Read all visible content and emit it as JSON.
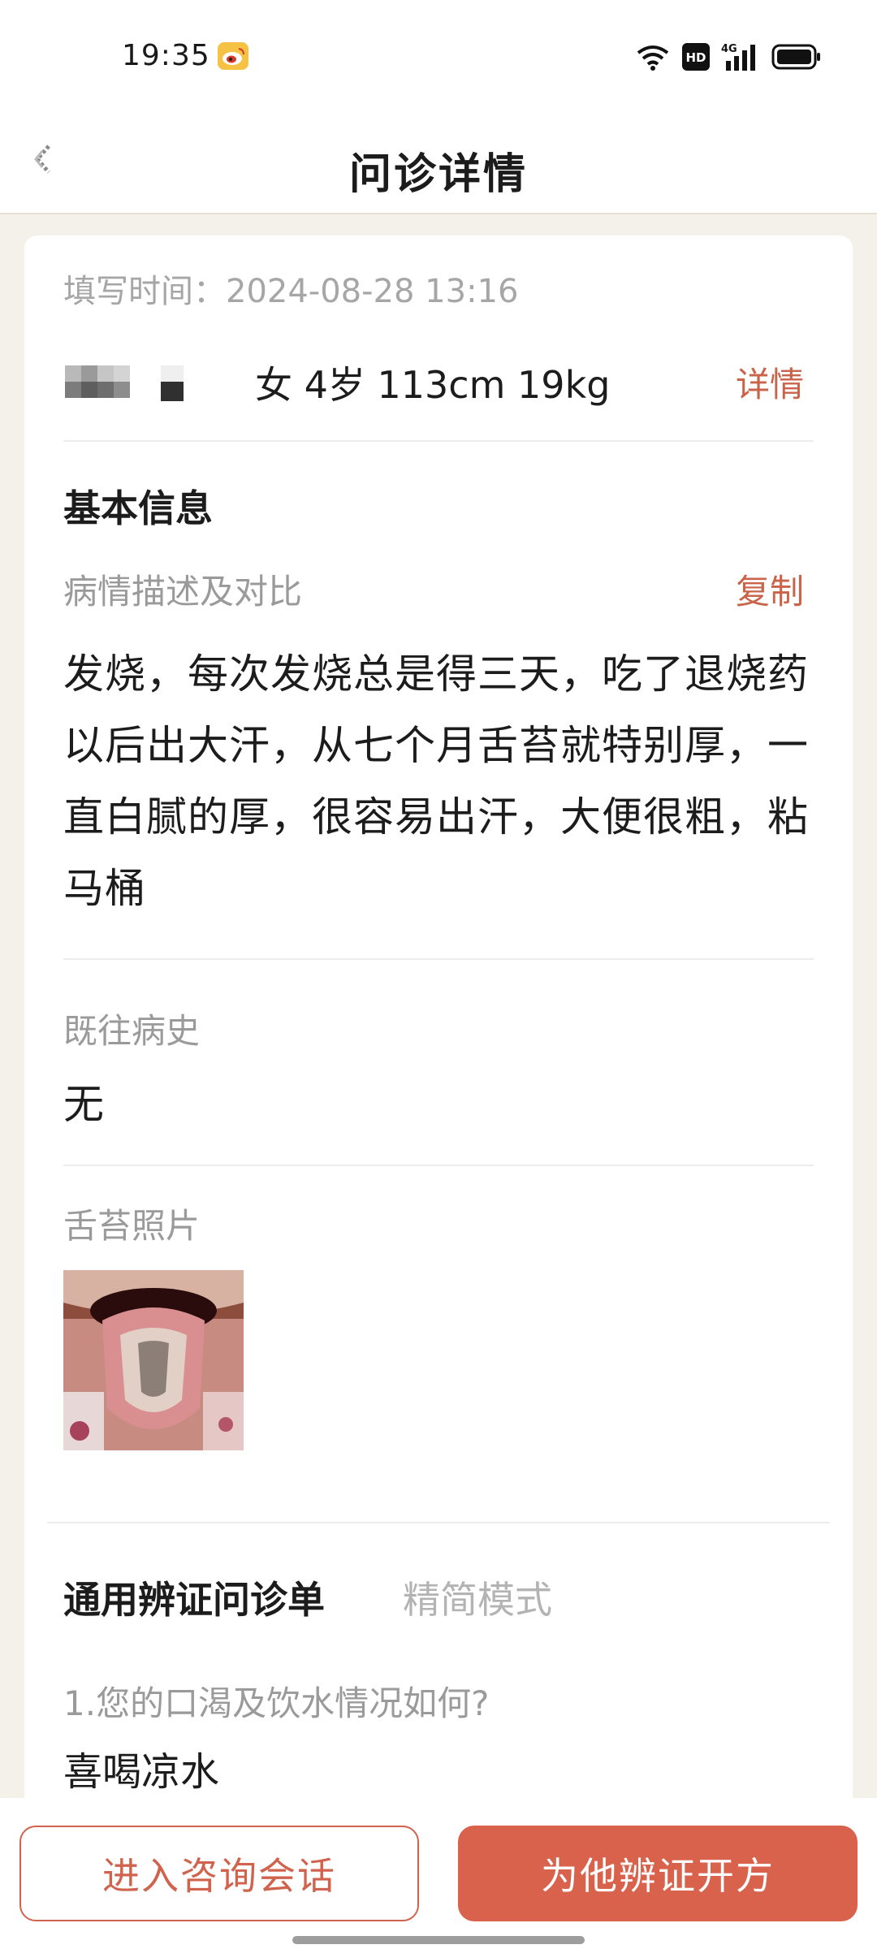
{
  "status_bar": {
    "time": "19:35",
    "app_icon": "weibo-icon",
    "indicators": [
      "wifi-icon",
      "hd-icon",
      "signal-4g-icon",
      "battery-icon"
    ],
    "hd_label": "HD",
    "network_label": "4G"
  },
  "nav": {
    "title": "问诊详情",
    "back_icon": "back-arrow-icon"
  },
  "record": {
    "fill_time": "填写时间：2024-08-28 13:16",
    "patient_info": "女 4岁 113cm 19kg",
    "detail_label": "详情"
  },
  "basic_info": {
    "title": "基本信息",
    "description_label": "病情描述及对比",
    "copy_label": "复制",
    "description": "发烧，每次发烧总是得三天，吃了退烧药以后出大汗，从七个月舌苔就特别厚，一直白腻的厚，很容易出汗，大便很粗，粘马桶",
    "history_label": "既往病史",
    "history_value": "无",
    "photo_label": "舌苔照片"
  },
  "questionnaire": {
    "title": "通用辨证问诊单",
    "mode_label": "精简模式",
    "questions": [
      {
        "q": "1.您的口渴及饮水情况如何?",
        "a": "喜喝凉水"
      }
    ]
  },
  "actions": {
    "consult_label": "进入咨询会话",
    "prescribe_label": "为他辨证开方"
  },
  "colors": {
    "accent": "#d9624c",
    "page_bg": "#f4f0ea",
    "muted_text": "#9a9a9a"
  }
}
